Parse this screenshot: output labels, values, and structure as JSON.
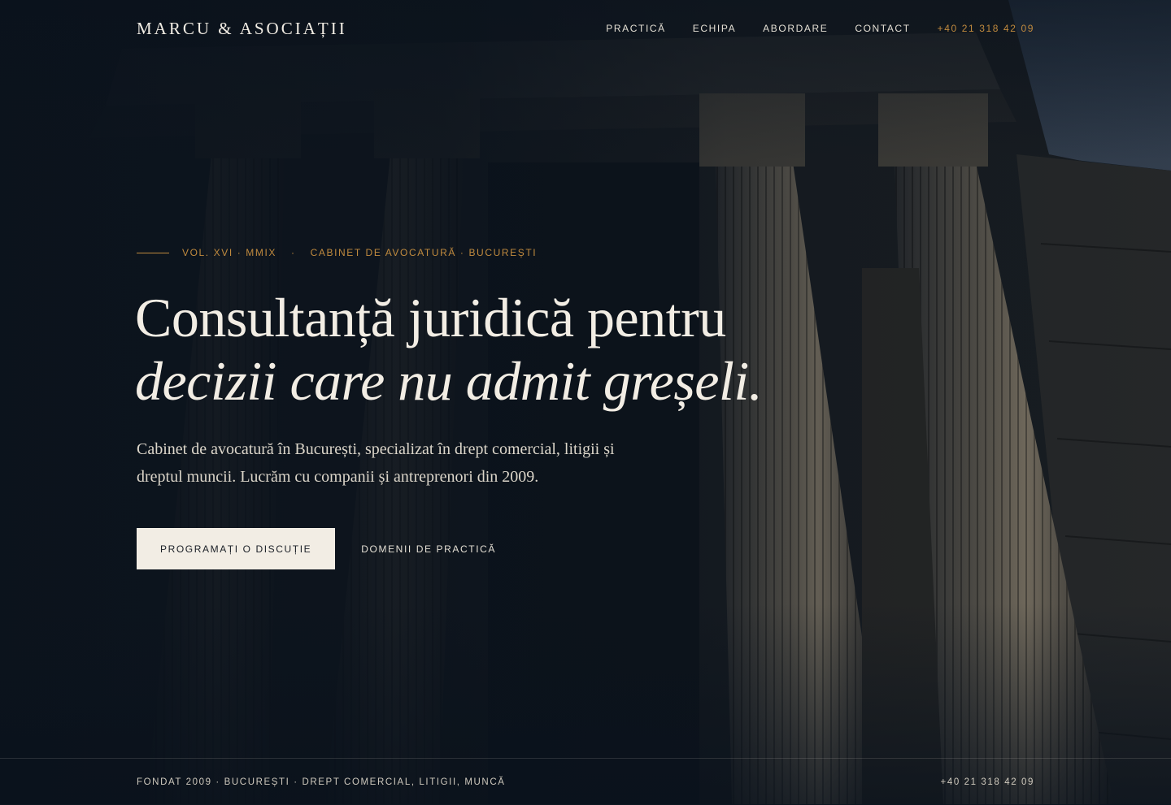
{
  "brand": {
    "name": "MARCU & ASOCIAȚII"
  },
  "nav": {
    "items": [
      {
        "label": "PRACTICĂ"
      },
      {
        "label": "ECHIPA"
      },
      {
        "label": "ABORDARE"
      },
      {
        "label": "CONTACT"
      }
    ],
    "phone": "+40 21 318 42 09"
  },
  "hero": {
    "eyebrow_part1": "VOL. XVI · MMIX",
    "eyebrow_separator": "·",
    "eyebrow_part2": "CABINET DE AVOCATURĂ · BUCUREȘTI",
    "headline_line1": "Consultanță juridică pentru",
    "headline_line2": "decizii care nu admit greșeli.",
    "lead": "Cabinet de avocatură în București, specializat în drept comercial, litigii și drep­tul muncii. Lucrăm cu companii și antreprenori din 2009.",
    "primary_cta": "PROGRAMAȚI O DISCUȚIE",
    "secondary_cta": "DOMENII DE PRACTICĂ"
  },
  "footer": {
    "left": "FONDAT 2009 · BUCUREȘTI · DREPT COMERCIAL, LITIGII, MUNCĂ",
    "phone": "+40 21 318 42 09"
  },
  "colors": {
    "background": "#0c1620",
    "accent": "#c08a3e",
    "ivory": "#f2ede4"
  }
}
